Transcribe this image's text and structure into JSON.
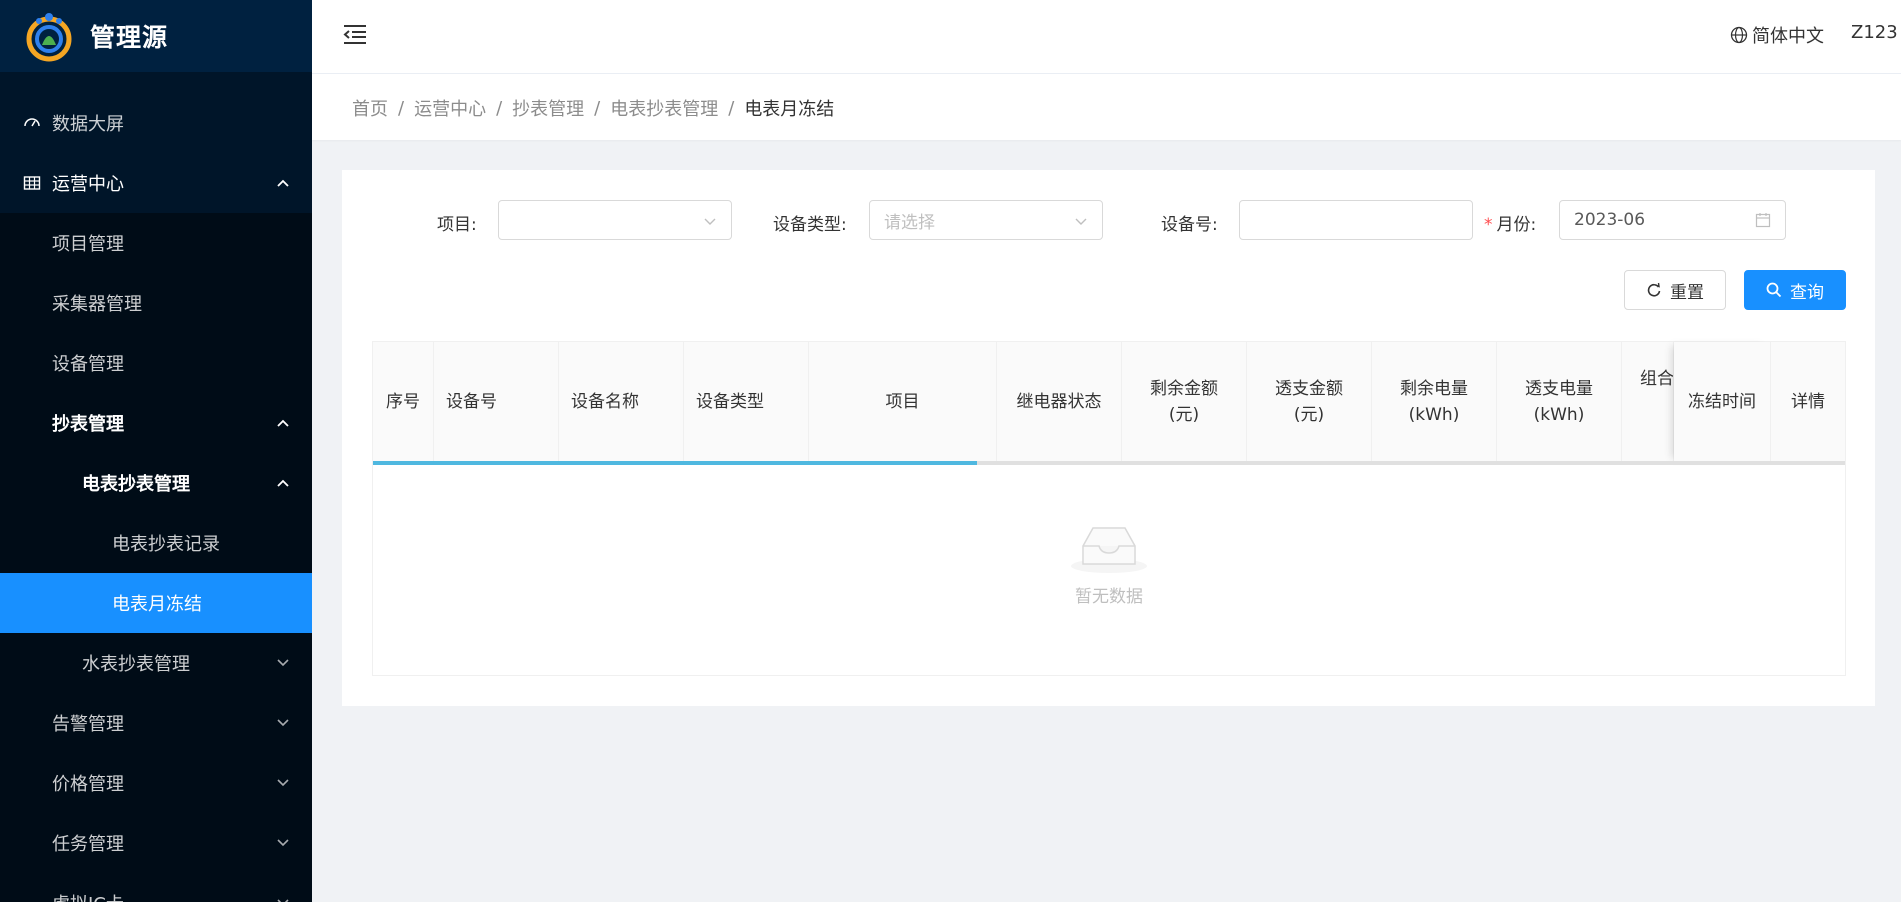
{
  "brand": {
    "title": "管理源"
  },
  "sidebar": {
    "items": [
      {
        "label": "数据大屏",
        "icon": "dashboard-icon"
      },
      {
        "label": "运营中心",
        "icon": "table-icon"
      },
      {
        "label": "项目管理"
      },
      {
        "label": "采集器管理"
      },
      {
        "label": "设备管理"
      },
      {
        "label": "抄表管理"
      },
      {
        "label": "电表抄表管理"
      },
      {
        "label": "电表抄表记录"
      },
      {
        "label": "电表月冻结"
      },
      {
        "label": "水表抄表管理"
      },
      {
        "label": "告警管理"
      },
      {
        "label": "价格管理"
      },
      {
        "label": "任务管理"
      },
      {
        "label": "虚拟IC卡"
      }
    ]
  },
  "header": {
    "language": "简体中文",
    "user": "Z123"
  },
  "breadcrumb": {
    "items": [
      "首页",
      "运营中心",
      "抄表管理",
      "电表抄表管理"
    ],
    "current": "电表月冻结"
  },
  "filters": {
    "project": {
      "label": "项目:",
      "value": ""
    },
    "device_type": {
      "label": "设备类型:",
      "placeholder": "请选择"
    },
    "device_no": {
      "label": "设备号:",
      "value": ""
    },
    "month": {
      "label": "月份:",
      "required_mark": "*",
      "value": "2023-06"
    }
  },
  "buttons": {
    "reset": "重置",
    "search": "查询"
  },
  "table": {
    "columns": [
      "序号",
      "设备号",
      "设备名称",
      "设备类型",
      "项目",
      "继电器状态",
      "剩余金额\n(元)",
      "透支金额\n(元)",
      "剩余电量\n(kWh)",
      "透支电量\n(kWh)",
      "组合",
      "冻结时间",
      "详情"
    ],
    "loading_progress": 0.41,
    "empty_text": "暂无数据"
  },
  "colors": {
    "sidebar_bg": "#001529",
    "sidebar_submenu_bg": "#000c17",
    "accent": "#1890ff",
    "progress": "#4fb8e0"
  }
}
